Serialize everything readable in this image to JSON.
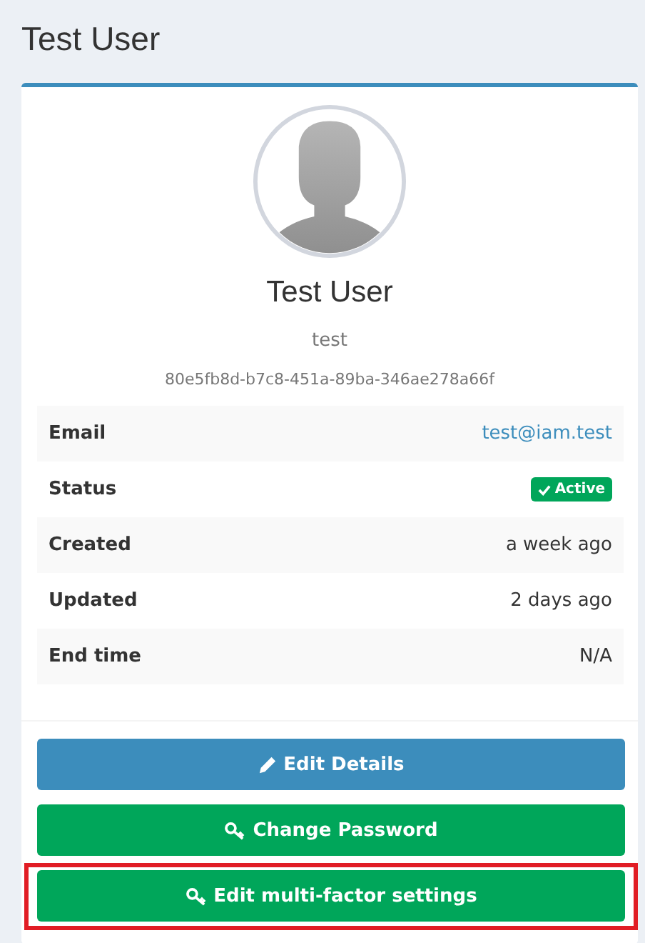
{
  "page_title": "Test User",
  "profile": {
    "name": "Test User",
    "username": "test",
    "id": "80e5fb8d-b7c8-451a-89ba-346ae278a66f"
  },
  "details": [
    {
      "label": "Email",
      "value": "test@iam.test",
      "kind": "link"
    },
    {
      "label": "Status",
      "value": "Active",
      "kind": "badge"
    },
    {
      "label": "Created",
      "value": "a week ago",
      "kind": "text"
    },
    {
      "label": "Updated",
      "value": "2 days ago",
      "kind": "text"
    },
    {
      "label": "End time",
      "value": "N/A",
      "kind": "text"
    }
  ],
  "buttons": [
    {
      "label": "Edit Details",
      "kind": "primary",
      "highlighted": false
    },
    {
      "label": "Change Password",
      "kind": "success",
      "highlighted": false
    },
    {
      "label": "Edit multi-factor settings",
      "kind": "success",
      "highlighted": true
    }
  ]
}
